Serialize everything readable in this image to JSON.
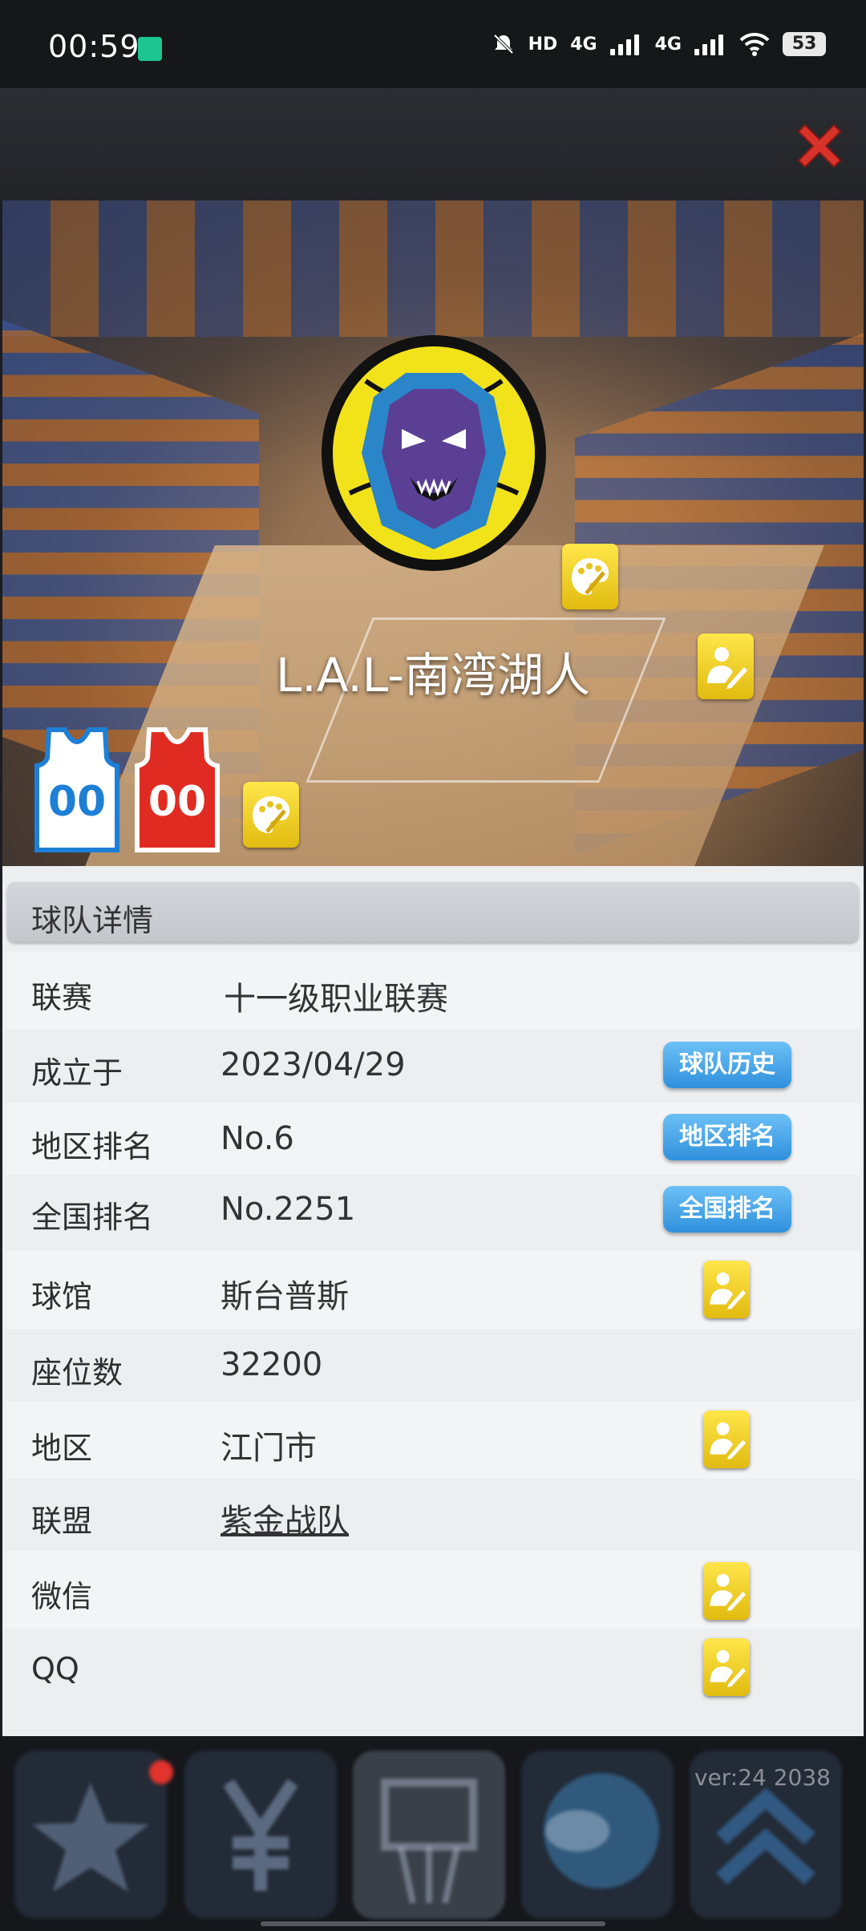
{
  "status_bar": {
    "time": "00:59",
    "network_hd": "HD",
    "network_1": "4G",
    "network_2": "4G",
    "battery": "53"
  },
  "header": {
    "close_icon": "close-icon"
  },
  "team": {
    "name": "L.A.L-南湾湖人",
    "home_jersey_number": "00",
    "away_jersey_number": "00",
    "colors": {
      "home_jersey": "#1e7fd6",
      "away_jersey": "#e02b22",
      "logo_ring": "#f2e21a"
    }
  },
  "details": {
    "title": "球队详情",
    "rows": [
      {
        "label": "联赛",
        "value": "十一级职业联赛"
      },
      {
        "label": "成立于",
        "value": "2023/04/29",
        "button": "球队历史"
      },
      {
        "label": "地区排名",
        "value": "No.6",
        "button": "地区排名"
      },
      {
        "label": "全国排名",
        "value": "No.2251",
        "button": "全国排名"
      },
      {
        "label": "球馆",
        "value": "斯台普斯"
      },
      {
        "label": "座位数",
        "value": "32200"
      },
      {
        "label": "地区",
        "value": "江门市"
      },
      {
        "label": "联盟",
        "value": "紫金战队"
      },
      {
        "label": "微信",
        "value": ""
      },
      {
        "label": "QQ",
        "value": ""
      }
    ]
  },
  "footer": {
    "version": "ver:24   2038"
  }
}
